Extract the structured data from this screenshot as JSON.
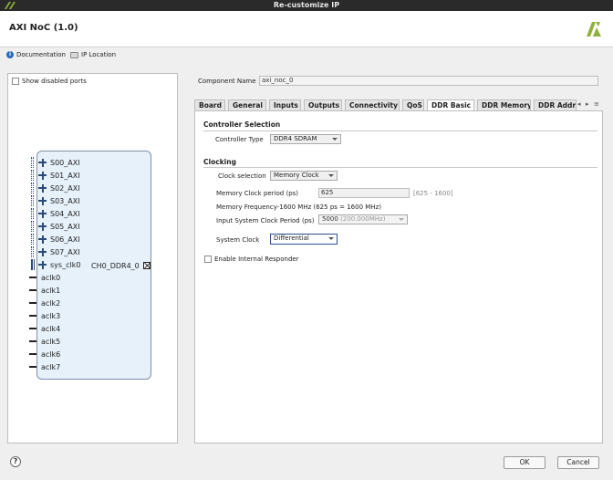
{
  "window": {
    "title": "Re-customize IP"
  },
  "header": {
    "title": "AXI NoC (1.0)"
  },
  "links": {
    "documentation": "Documentation",
    "ip_location": "IP Location"
  },
  "left": {
    "show_disabled_label": "Show disabled ports",
    "input_ports": [
      "S00_AXI",
      "S01_AXI",
      "S02_AXI",
      "S03_AXI",
      "S04_AXI",
      "S05_AXI",
      "S06_AXI",
      "S07_AXI"
    ],
    "clock_port": "sys_clk0",
    "output_port": "CH0_DDR4_0",
    "aclk_ports": [
      "aclk0",
      "aclk1",
      "aclk2",
      "aclk3",
      "aclk4",
      "aclk5",
      "aclk6",
      "aclk7"
    ]
  },
  "right": {
    "component_name_label": "Component Name",
    "component_name_value": "axi_noc_0",
    "tabs": [
      "Board",
      "General",
      "Inputs",
      "Outputs",
      "Connectivity",
      "QoS",
      "DDR Basic",
      "DDR Memory",
      "DDR Addre"
    ],
    "active_tab": "DDR Basic",
    "controller_selection": {
      "title": "Controller Selection",
      "controller_type_label": "Controller Type",
      "controller_type_value": "DDR4 SDRAM"
    },
    "clocking": {
      "title": "Clocking",
      "clock_selection_label": "Clock selection",
      "clock_selection_value": "Memory Clock",
      "memory_clock_period_label": "Memory Clock period (ps)",
      "memory_clock_period_value": "625",
      "memory_clock_period_range": "[625 - 1600]",
      "memory_frequency_text": "Memory Frequency-1600 MHz (625 ps = 1600 MHz)",
      "input_system_clock_label": "Input System Clock Period (ps)",
      "input_system_clock_value": "5000",
      "input_system_clock_hint": "(200.000MHz)",
      "system_clock_label": "System Clock",
      "system_clock_value": "Differential"
    },
    "enable_internal_responder": "Enable Internal Responder"
  },
  "footer": {
    "help": "?",
    "ok": "OK",
    "cancel": "Cancel"
  },
  "colors": {
    "titlebar": "#2a2a2a",
    "block_fill": "#e6f1fa",
    "block_border": "#7e8fa8",
    "brand_green": "#8fb33a"
  }
}
